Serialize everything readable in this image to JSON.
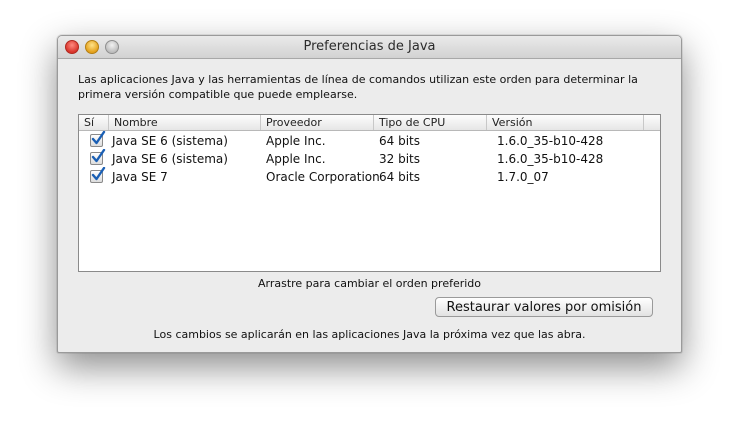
{
  "window": {
    "title": "Preferencias de Java"
  },
  "description": "Las aplicaciones Java y las herramientas de línea de comandos utilizan este orden para determinar la primera versión compatible que puede emplearse.",
  "table": {
    "columns": [
      "Sí",
      "Nombre",
      "Proveedor",
      "Tipo de CPU",
      "Versión"
    ],
    "rows": [
      {
        "enabled": true,
        "name": "Java SE 6 (sistema)",
        "vendor": "Apple Inc.",
        "cpu": "64 bits",
        "version": "1.6.0_35-b10-428"
      },
      {
        "enabled": true,
        "name": "Java SE 6 (sistema)",
        "vendor": "Apple Inc.",
        "cpu": "32 bits",
        "version": "1.6.0_35-b10-428"
      },
      {
        "enabled": true,
        "name": "Java SE 7",
        "vendor": "Oracle Corporation",
        "cpu": "64 bits",
        "version": "1.7.0_07"
      }
    ]
  },
  "hint": "Arrastre para cambiar el orden preferido",
  "restore_button": "Restaurar valores por omisión",
  "footer": "Los cambios se aplicarán en las aplicaciones Java la próxima vez que las abra.",
  "colors": {
    "check": "#1a5fb4",
    "window_bg": "#ececec"
  }
}
